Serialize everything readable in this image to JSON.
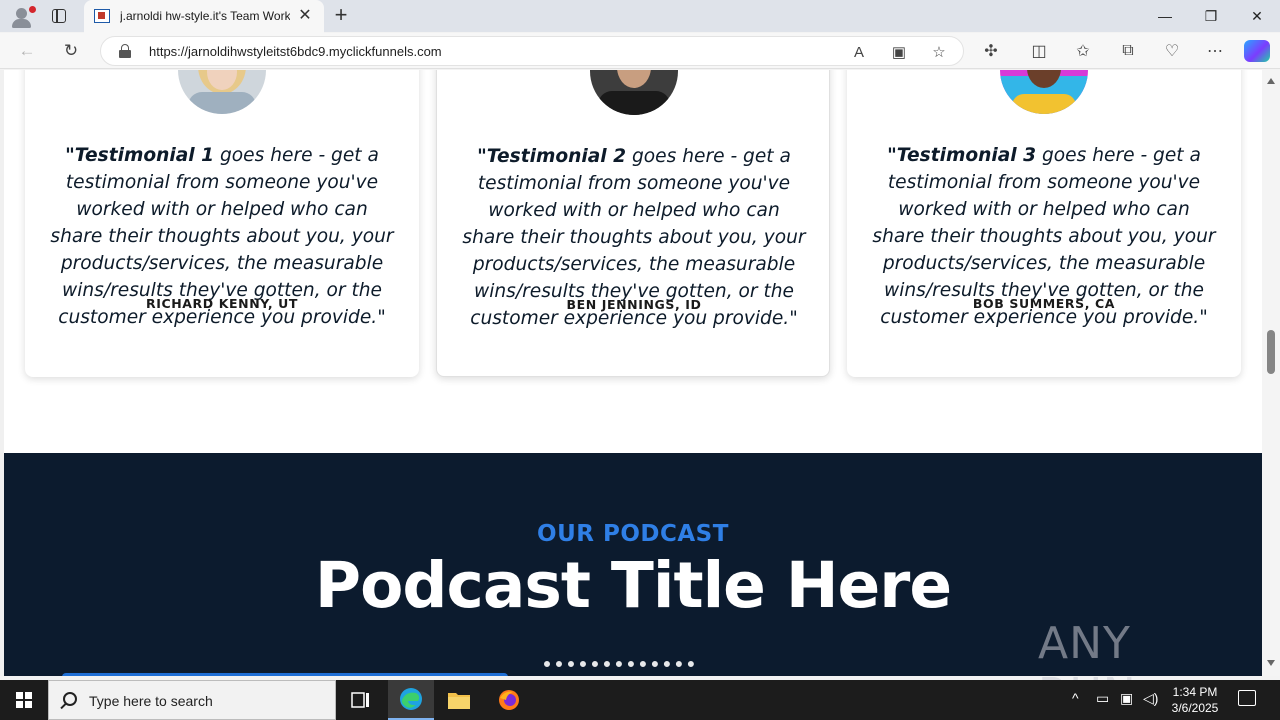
{
  "browser": {
    "tab_title": "j.arnoldi hw-style.it's Team Work",
    "url_prefix": "https://",
    "url_host": "jarnoldihwstyleitst6bdc9.myclickfunnels.com"
  },
  "testimonials": [
    {
      "quote_bold": "\"Testimonial 1",
      "quote_rest": " goes here - get a testimonial from someone you've worked with or helped who can share their thoughts about you, your products/services, the measurable wins/results they've gotten, or the customer experience you provide.\"",
      "author": "RICHARD KENNY, UT"
    },
    {
      "quote_bold": "\"Testimonial 2",
      "quote_rest": " goes here - get a testimonial from someone you've worked with or helped who can share their thoughts about you, your products/services, the measurable wins/results they've gotten, or the customer experience you provide.\"",
      "author": "BEN JENNINGS, ID"
    },
    {
      "quote_bold": "\"Testimonial 3",
      "quote_rest": " goes here - get a testimonial from someone you've worked with or helped who can share their thoughts about you, your products/services, the measurable wins/results they've gotten, or the customer experience you provide.\"",
      "author": "BOB SUMMERS, CA"
    }
  ],
  "podcast": {
    "kicker": "OUR PODCAST",
    "title": "Podcast Title Here"
  },
  "watermark": "ANY RUN",
  "taskbar": {
    "search_placeholder": "Type here to search",
    "time": "1:34 PM",
    "date": "3/6/2025"
  },
  "colors": {
    "podcast_bg": "#0c1b2e",
    "podcast_kicker": "#2f7fe6",
    "taskbar_bg": "#1c1c1c"
  }
}
